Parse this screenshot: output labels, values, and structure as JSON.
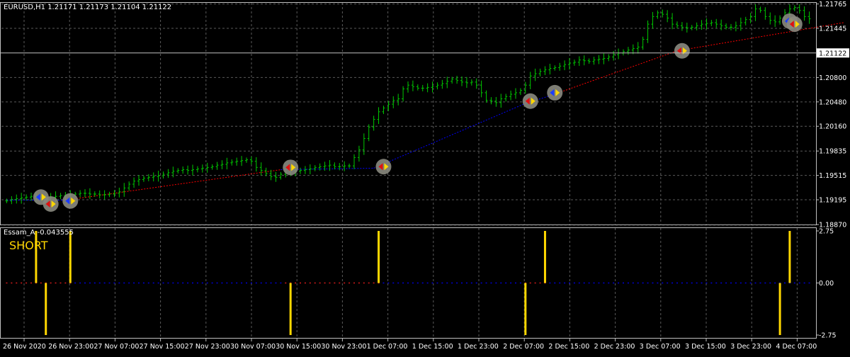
{
  "chart_data": [
    {
      "type": "candlestick-bars",
      "title": "EURUSD,H1  1.21171 1.21173 1.21104 1.21122",
      "symbol": "EURUSD",
      "timeframe": "H1",
      "ohlc_last": {
        "open": 1.21171,
        "high": 1.21173,
        "low": 1.21104,
        "close": 1.21122
      },
      "current_price": 1.21122,
      "current_price_label": "1.21122",
      "ylim": [
        1.1887,
        1.2178
      ],
      "y_ticks": [
        "1.21765",
        "1.21445",
        "1.21122",
        "1.20800",
        "1.20480",
        "1.20160",
        "1.19835",
        "1.19515",
        "1.19195",
        "1.18870"
      ],
      "x_ticks": [
        "26 Nov 2020",
        "26 Nov 23:00",
        "27 Nov 07:00",
        "27 Nov 15:00",
        "27 Nov 23:00",
        "30 Nov 07:00",
        "30 Nov 15:00",
        "30 Nov 23:00",
        "1 Dec 07:00",
        "1 Dec 15:00",
        "1 Dec 23:00",
        "2 Dec 07:00",
        "2 Dec 15:00",
        "2 Dec 23:00",
        "3 Dec 07:00",
        "3 Dec 15:00",
        "3 Dec 23:00",
        "4 Dec 07:00"
      ],
      "bar_color": "#00c800",
      "close_series": [
        1.1918,
        1.192,
        1.1921,
        1.1922,
        1.1923,
        1.1924,
        1.1922,
        1.1921,
        1.1922,
        1.1923,
        1.1924,
        1.1925,
        1.1925,
        1.1926,
        1.1927,
        1.1928,
        1.1928,
        1.1927,
        1.1927,
        1.1926,
        1.1926,
        1.1927,
        1.1928,
        1.193,
        1.1935,
        1.194,
        1.1944,
        1.1946,
        1.1948,
        1.1949,
        1.195,
        1.1951,
        1.1953,
        1.1955,
        1.1957,
        1.1958,
        1.1959,
        1.1958,
        1.1959,
        1.196,
        1.1961,
        1.1962,
        1.1963,
        1.1965,
        1.1966,
        1.1968,
        1.1969,
        1.197,
        1.1971,
        1.1972,
        1.197,
        1.1962,
        1.1958,
        1.1954,
        1.195,
        1.1949,
        1.1953,
        1.1956,
        1.1958,
        1.1957,
        1.1958,
        1.1959,
        1.196,
        1.1962,
        1.1963,
        1.1964,
        1.1965,
        1.1963,
        1.1963,
        1.1964,
        1.1964,
        1.1975,
        1.1985,
        1.2,
        1.2015,
        1.2025,
        1.2035,
        1.204,
        1.2045,
        1.205,
        1.2052,
        1.2065,
        1.207,
        1.2068,
        1.2066,
        1.2066,
        1.2067,
        1.2068,
        1.207,
        1.2072,
        1.2075,
        1.2078,
        1.2076,
        1.2074,
        1.2073,
        1.2074,
        1.207,
        1.206,
        1.205,
        1.2049,
        1.2047,
        1.2052,
        1.2055,
        1.2058,
        1.206,
        1.2063,
        1.207,
        1.2082,
        1.2085,
        1.2088,
        1.209,
        1.2092,
        1.2093,
        1.2095,
        1.2097,
        1.2099,
        1.21,
        1.2103,
        1.2102,
        1.2101,
        1.2103,
        1.2104,
        1.2105,
        1.2107,
        1.211,
        1.2112,
        1.2114,
        1.2116,
        1.2118,
        1.212,
        1.213,
        1.215,
        1.216,
        1.2165,
        1.2163,
        1.2158,
        1.215,
        1.2148,
        1.2146,
        1.2145,
        1.2146,
        1.2148,
        1.215,
        1.2151,
        1.2152,
        1.215,
        1.2148,
        1.2146,
        1.2146,
        1.2148,
        1.2152,
        1.2156,
        1.216,
        1.217,
        1.2168,
        1.216,
        1.2155,
        1.2153,
        1.2158,
        1.2165,
        1.217,
        1.2172,
        1.2168,
        1.216,
        1.2157
      ],
      "signal_line": {
        "color_up": "#0000ff",
        "color_down": "#ff0000",
        "points": [
          [
            0,
            1.1919,
            "down"
          ],
          [
            7,
            1.1919,
            "up"
          ],
          [
            12,
            1.1919,
            "up"
          ],
          [
            56,
            1.1959,
            "down"
          ],
          [
            75,
            1.1961,
            "up"
          ],
          [
            106,
            1.2046,
            "up"
          ],
          [
            111,
            1.2056,
            "up"
          ],
          [
            137,
            1.2115,
            "down"
          ],
          [
            171,
            1.2152,
            "down"
          ]
        ]
      },
      "markers": [
        {
          "bar": 7,
          "price": 1.1923,
          "side": "buy"
        },
        {
          "bar": 9,
          "price": 1.1914,
          "side": "sell"
        },
        {
          "bar": 13,
          "price": 1.1918,
          "side": "buy"
        },
        {
          "bar": 58,
          "price": 1.1962,
          "side": "sell"
        },
        {
          "bar": 77,
          "price": 1.1963,
          "side": "sell"
        },
        {
          "bar": 107,
          "price": 1.2049,
          "side": "sell"
        },
        {
          "bar": 112,
          "price": 1.206,
          "side": "buy"
        },
        {
          "bar": 138,
          "price": 1.2115,
          "side": "sell"
        },
        {
          "bar": 160,
          "price": 1.2154,
          "side": "buy"
        },
        {
          "bar": 161,
          "price": 1.215,
          "side": "sell"
        }
      ]
    },
    {
      "type": "histogram",
      "title": "Essam_A -0.043555",
      "signal_text": "SHORT",
      "ylim": [
        -2.9,
        2.9
      ],
      "y_ticks": [
        "2.75",
        "0.00",
        "-2.75"
      ],
      "zero_line_color": "#0000ff",
      "bar_color": "#ffd700",
      "spikes": [
        {
          "bar": 6,
          "value": 2.75
        },
        {
          "bar": 8,
          "value": -2.75
        },
        {
          "bar": 13,
          "value": 2.75
        },
        {
          "bar": 58,
          "value": -2.75
        },
        {
          "bar": 76,
          "value": 2.75
        },
        {
          "bar": 106,
          "value": -2.75
        },
        {
          "bar": 110,
          "value": 2.75
        },
        {
          "bar": 158,
          "value": -2.75
        },
        {
          "bar": 160,
          "value": 2.75
        }
      ]
    }
  ]
}
